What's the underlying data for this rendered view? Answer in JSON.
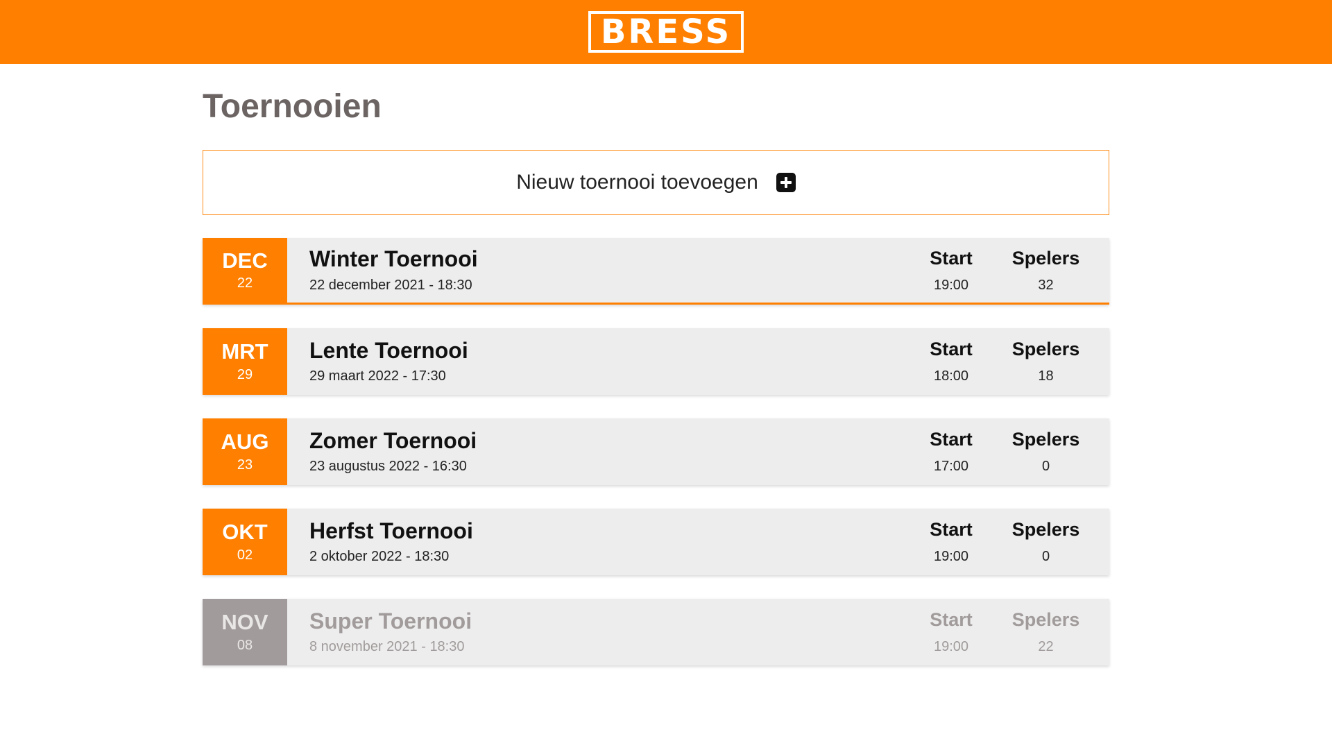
{
  "header": {
    "logo_text": "BRESS",
    "brand_color": "#ff7f00"
  },
  "page": {
    "title": "Toernooien"
  },
  "add_button": {
    "label": "Nieuw toernooi toevoegen",
    "icon": "plus-square-icon"
  },
  "columns": {
    "start": "Start",
    "players": "Spelers"
  },
  "tournaments": [
    {
      "month": "DEC",
      "day": "22",
      "name": "Winter Toernooi",
      "datetime": "22 december 2021 - 18:30",
      "start": "19:00",
      "players": "32",
      "state": "active"
    },
    {
      "month": "MRT",
      "day": "29",
      "name": "Lente Toernooi",
      "datetime": "29 maart 2022 - 17:30",
      "start": "18:00",
      "players": "18",
      "state": "upcoming"
    },
    {
      "month": "AUG",
      "day": "23",
      "name": "Zomer Toernooi",
      "datetime": "23 augustus 2022 - 16:30",
      "start": "17:00",
      "players": "0",
      "state": "upcoming"
    },
    {
      "month": "OKT",
      "day": "02",
      "name": "Herfst Toernooi",
      "datetime": "2 oktober 2022 - 18:30",
      "start": "19:00",
      "players": "0",
      "state": "upcoming"
    },
    {
      "month": "NOV",
      "day": "08",
      "name": "Super Toernooi",
      "datetime": "8 november 2021 - 18:30",
      "start": "19:00",
      "players": "22",
      "state": "past"
    }
  ]
}
